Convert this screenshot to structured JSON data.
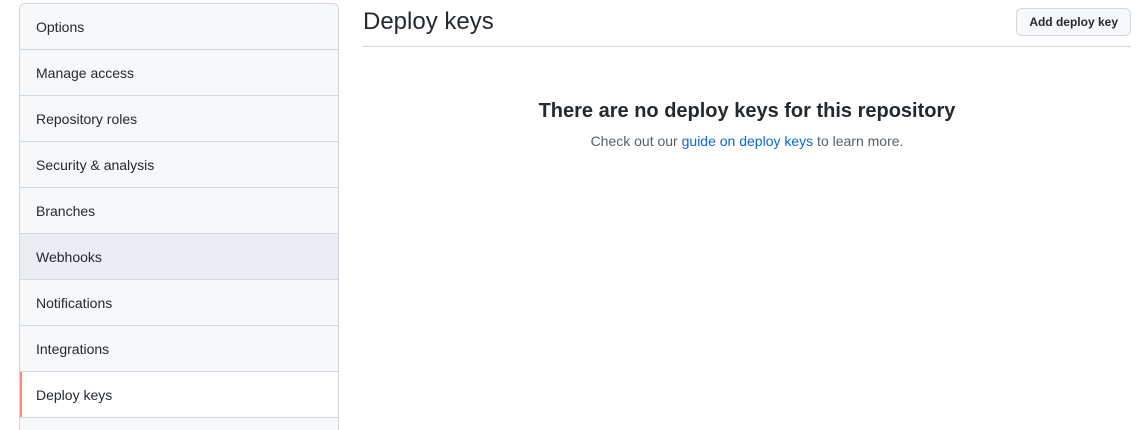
{
  "sidebar": {
    "items": [
      {
        "label": "Options"
      },
      {
        "label": "Manage access"
      },
      {
        "label": "Repository roles"
      },
      {
        "label": "Security & analysis"
      },
      {
        "label": "Branches"
      },
      {
        "label": "Webhooks"
      },
      {
        "label": "Notifications"
      },
      {
        "label": "Integrations"
      },
      {
        "label": "Deploy keys"
      }
    ],
    "selected_label": "Deploy keys",
    "selected_accent_color": "#fd8c73"
  },
  "main": {
    "title": "Deploy keys",
    "add_button_label": "Add deploy key",
    "empty_state": {
      "heading": "There are no deploy keys for this repository",
      "text_before": "Check out our ",
      "link_text": "guide on deploy keys",
      "text_after": " to learn more.",
      "link_color": "#0969da"
    }
  }
}
